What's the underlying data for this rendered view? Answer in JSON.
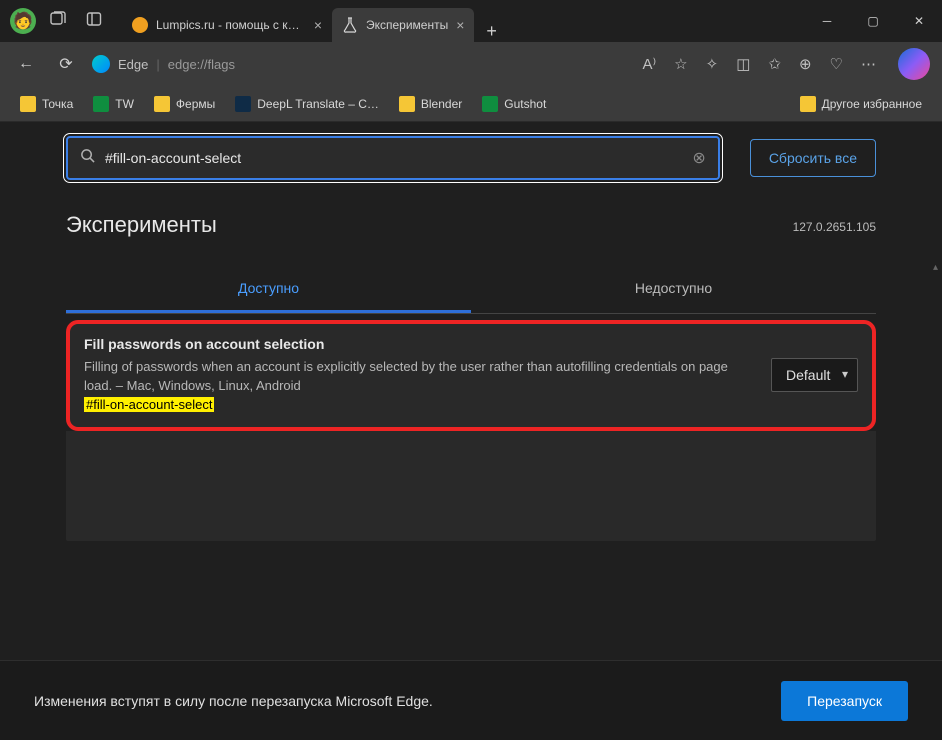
{
  "tabs": [
    {
      "title": "Lumpics.ru - помощь с компью"
    },
    {
      "title": "Эксперименты"
    }
  ],
  "toolbar": {
    "brand": "Edge",
    "url": "edge://flags"
  },
  "bookmarks": {
    "items": [
      "Точка",
      "TW",
      "Фермы",
      "DeepL Translate – C…",
      "Blender",
      "Gutshot"
    ],
    "other": "Другое избранное"
  },
  "search": {
    "value": "#fill-on-account-select",
    "reset": "Сбросить все"
  },
  "page": {
    "heading": "Эксперименты",
    "version": "127.0.2651.105",
    "tab_available": "Доступно",
    "tab_unavailable": "Недоступно"
  },
  "flag": {
    "title": "Fill passwords on account selection",
    "desc": "Filling of passwords when an account is explicitly selected by the user rather than autofilling credentials on page load. – Mac, Windows, Linux, Android",
    "hash": "#fill-on-account-select",
    "select": "Default"
  },
  "footer": {
    "msg": "Изменения вступят в силу после перезапуска Microsoft Edge.",
    "restart": "Перезапуск"
  }
}
